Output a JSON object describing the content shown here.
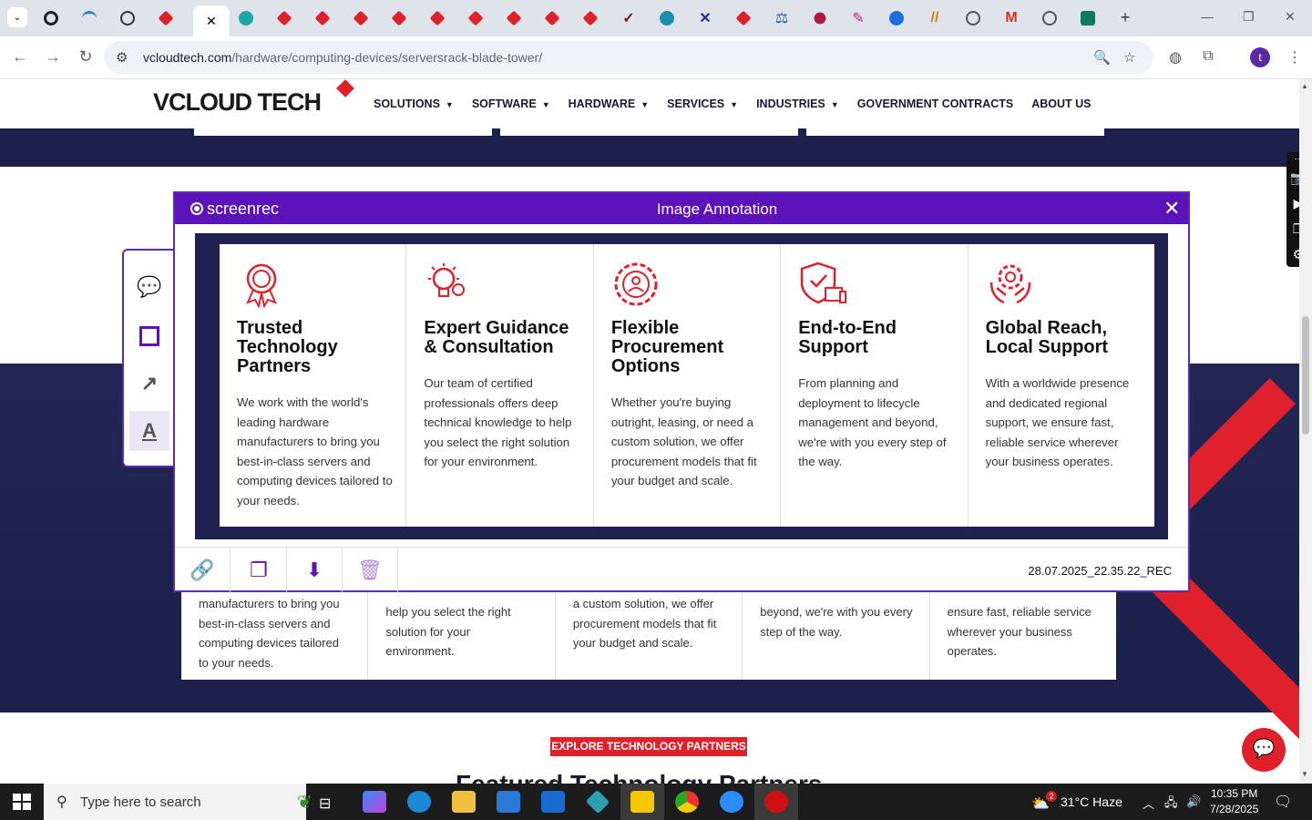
{
  "browser": {
    "url_host": "vcloudtech.com",
    "url_path": "/hardware/computing-devices/serversrack-blade-tower/",
    "profile_initial": "t"
  },
  "site": {
    "logo_text_1": "VCLOUD",
    "logo_text_2": " TECH",
    "nav": [
      {
        "label": "SOLUTIONS",
        "caret": "▼"
      },
      {
        "label": "SOFTWARE",
        "caret": "▼"
      },
      {
        "label": "HARDWARE",
        "caret": "▼"
      },
      {
        "label": "SERVICES",
        "caret": "▼"
      },
      {
        "label": "INDUSTRIES",
        "caret": "▼"
      },
      {
        "label": "GOVERNMENT CONTRACTS",
        "caret": ""
      },
      {
        "label": "ABOUT US",
        "caret": ""
      }
    ],
    "bg_cards": [
      "manufacturers to bring you best-in-class servers and computing devices tailored to your needs.",
      "help you select the right solution for your environment.",
      "a custom solution, we offer procurement models that fit your budget and scale.",
      "beyond, we're with you every step of the way.",
      "ensure fast, reliable service wherever your business operates."
    ],
    "explore_button": "EXPLORE TECHNOLOGY PARTNERS",
    "featured_heading": "Featured Technology Partners"
  },
  "dialog": {
    "brand": "screenrec",
    "title": "Image Annotation",
    "close": "✕",
    "filename": "28.07.2025_22.35.22_REC",
    "features": [
      {
        "title": "Trusted Technology Partners",
        "desc": "We work with the world's leading hardware manufacturers to bring you best-in-class servers and computing devices tailored to your needs.",
        "icon": "award-icon"
      },
      {
        "title": "Expert Guidance & Consultation",
        "desc": "Our team of certified professionals offers deep technical knowledge to help you select the right solution for your environment.",
        "icon": "lightbulb-gear-icon"
      },
      {
        "title": "Flexible Procurement Options",
        "desc": "Whether you're buying outright, leasing, or need a custom solution, we offer procurement models that fit your budget and scale.",
        "icon": "gear-person-icon"
      },
      {
        "title": "End-to-End Support",
        "desc": "From planning and deployment to lifecycle management and beyond, we're with you every step of the way.",
        "icon": "shield-devices-icon"
      },
      {
        "title": "Global Reach, Local Support",
        "desc": "With a worldwide presence and dedicated regional support, we ensure fast, reliable service wherever your business operates.",
        "icon": "hands-gear-icon"
      }
    ]
  },
  "taskbar": {
    "search_placeholder": "Type here to search",
    "weather": "31°C  Haze",
    "weather_badge": "2",
    "time": "10:35 PM",
    "date": "7/28/2025"
  },
  "colors": {
    "accent": "#5b12b8",
    "brand_red": "#e0202a",
    "navy": "#1b1f4a"
  }
}
